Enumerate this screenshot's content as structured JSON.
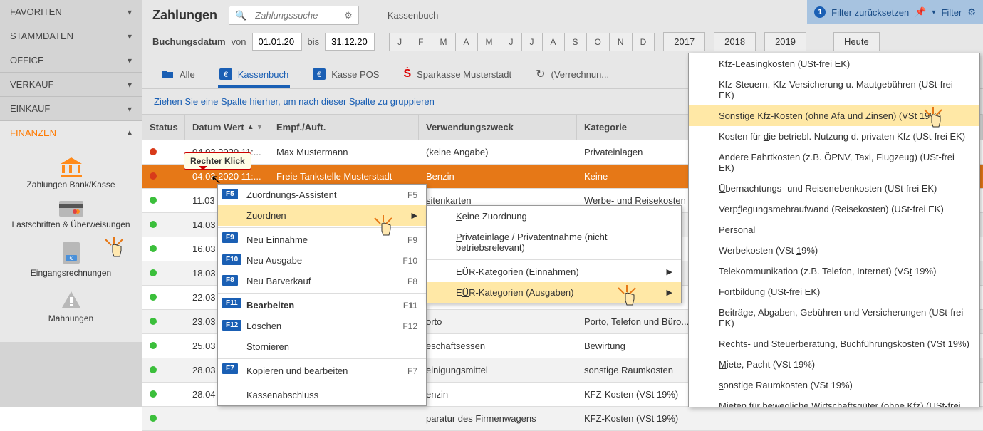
{
  "sidebar": {
    "items": [
      {
        "label": "FAVORITEN"
      },
      {
        "label": "STAMMDATEN"
      },
      {
        "label": "OFFICE"
      },
      {
        "label": "VERKAUF"
      },
      {
        "label": "EINKAUF"
      },
      {
        "label": "FINANZEN"
      }
    ],
    "sub": [
      {
        "label": "Zahlungen Bank/Kasse"
      },
      {
        "label": "Lastschriften & Überweisungen"
      },
      {
        "label": "Eingangsrechnungen"
      },
      {
        "label": "Mahnungen"
      }
    ]
  },
  "header": {
    "title": "Zahlungen",
    "search_placeholder": "Zahlungssuche",
    "kassenbuch": "Kassenbuch"
  },
  "filterbar": {
    "count": "1",
    "reset": "Filter zurücksetzen",
    "filter": "Filter"
  },
  "datebar": {
    "label": "Buchungsdatum",
    "von": "von",
    "from": "01.01.20",
    "bis": "bis",
    "to": "31.12.20",
    "months": [
      "J",
      "F",
      "M",
      "A",
      "M",
      "J",
      "J",
      "A",
      "S",
      "O",
      "N",
      "D"
    ],
    "years": [
      "2017",
      "2018",
      "2019"
    ],
    "today": "Heute"
  },
  "tabs": [
    {
      "label": "Alle"
    },
    {
      "label": "Kassenbuch"
    },
    {
      "label": "Kasse POS"
    },
    {
      "label": "Sparkasse Musterstadt"
    },
    {
      "label": "(Verrechnun..."
    }
  ],
  "group_hint": "Ziehen Sie eine Spalte hierher, um nach dieser Spalte zu gruppieren",
  "columns": {
    "status": "Status",
    "date": "Datum Wert",
    "emp": "Empf./Auft.",
    "zweck": "Verwendungszweck",
    "kat": "Kategorie"
  },
  "rows": [
    {
      "dot": "r",
      "date": "04.03.2020 11:...",
      "emp": "Max Mustermann",
      "zweck": "(keine Angabe)",
      "kat": "Privateinlagen"
    },
    {
      "dot": "r",
      "date": "04.03.2020 11:...",
      "emp": "Freie Tankstelle Musterstadt",
      "zweck": "Benzin",
      "kat": "Keine",
      "sel": true
    },
    {
      "dot": "g",
      "date": "11.03",
      "emp": "",
      "zweck": "sitenkarten",
      "kat": "Werbe- und Reisekosten"
    },
    {
      "dot": "g",
      "date": "14.03",
      "emp": "",
      "zweck": "",
      "kat": ""
    },
    {
      "dot": "g",
      "date": "16.03",
      "emp": "",
      "zweck": "",
      "kat": ""
    },
    {
      "dot": "g",
      "date": "18.03",
      "emp": "",
      "zweck": "",
      "kat": ""
    },
    {
      "dot": "g",
      "date": "22.03",
      "emp": "",
      "zweck": "",
      "kat": ""
    },
    {
      "dot": "g",
      "date": "23.03",
      "emp": "",
      "zweck": "orto",
      "kat": "Porto, Telefon und Büro..."
    },
    {
      "dot": "g",
      "date": "25.03",
      "emp": "",
      "zweck": "eschäftsessen",
      "kat": "Bewirtung"
    },
    {
      "dot": "g",
      "date": "28.03",
      "emp": "",
      "zweck": "einigungsmittel",
      "kat": "sonstige Raumkosten"
    },
    {
      "dot": "g",
      "date": "28.04",
      "emp": "",
      "zweck": "enzin",
      "kat": "KFZ-Kosten (VSt 19%)"
    },
    {
      "dot": "g",
      "date": "",
      "emp": "",
      "zweck": "paratur des Firmenwagens",
      "kat": "KFZ-Kosten (VSt 19%)"
    }
  ],
  "tooltip": "Rechter Klick",
  "menu1": [
    {
      "fkey": "F5",
      "label": "Zuordnungs-Assistent",
      "key": "F5"
    },
    {
      "label": "Zuordnen",
      "arrow": true,
      "hi": true
    },
    {
      "fkey": "F9",
      "label": "Neu Einnahme",
      "key": "F9",
      "sep": true
    },
    {
      "fkey": "F10",
      "label": "Neu Ausgabe",
      "key": "F10"
    },
    {
      "fkey": "F8",
      "label": "Neu Barverkauf",
      "key": "F8"
    },
    {
      "fkey": "F11",
      "label": "Bearbeiten",
      "key": "F11",
      "bold": true,
      "sep": true
    },
    {
      "fkey": "F12",
      "label": "Löschen",
      "key": "F12"
    },
    {
      "label": "Stornieren"
    },
    {
      "fkey": "F7",
      "label": "Kopieren und bearbeiten",
      "key": "F7",
      "sep": true
    },
    {
      "label": "Kassenabschluss",
      "sep": true
    }
  ],
  "menu2": [
    {
      "label": "Keine Zuordnung",
      "u": 0
    },
    {
      "label": "Privateinlage / Privatentnahme (nicht betriebsrelevant)",
      "u": 0
    },
    {
      "label": "EÜR-Kategorien (Einnahmen)",
      "u": 1,
      "arrow": true,
      "sep": true
    },
    {
      "label": "EÜR-Kategorien (Ausgaben)",
      "u": 1,
      "arrow": true,
      "hi": true
    }
  ],
  "menu3": [
    {
      "label": "Kfz-Leasingkosten (USt-frei EK)",
      "u": 0
    },
    {
      "label": "Kfz-Steuern, Kfz-Versicherung u. Mautgebühren (USt-frei EK)"
    },
    {
      "label": "Sonstige Kfz-Kosten (ohne Afa und Zinsen) (VSt 19%)",
      "u": 1,
      "hi": true
    },
    {
      "label": "Kosten für die betriebl. Nutzung d. privaten Kfz (USt-frei EK)",
      "u": 11
    },
    {
      "label": "Andere Fahrtkosten (z.B. ÖPNV, Taxi, Flugzeug) (USt-frei EK)"
    },
    {
      "label": "Übernachtungs- und Reisenebenkosten (USt-frei EK)",
      "u": 0
    },
    {
      "label": "Verpflegungsmehraufwand (Reisekosten) (USt-frei EK)",
      "u": 4
    },
    {
      "label": "Personal",
      "u": 0
    },
    {
      "label": "Werbekosten (VSt 19%)",
      "u": 17
    },
    {
      "label": "Telekommunikation (z.B. Telefon, Internet) (VSt 19%)",
      "u": 46
    },
    {
      "label": "Fortbildung (USt-frei EK)",
      "u": 0
    },
    {
      "label": "Beiträge, Abgaben, Gebühren und Versicherungen (USt-frei EK)",
      "u": 6
    },
    {
      "label": "Rechts- und Steuerberatung, Buchführungskosten (VSt 19%)",
      "u": 0
    },
    {
      "label": "Miete, Pacht (VSt 19%)",
      "u": 0
    },
    {
      "label": "sonstige Raumkosten (VSt 19%)",
      "u": 0
    },
    {
      "label": "Mieten für bewegliche Wirtschaftsgüter (ohne Kfz) (USt-frei EK)"
    }
  ]
}
